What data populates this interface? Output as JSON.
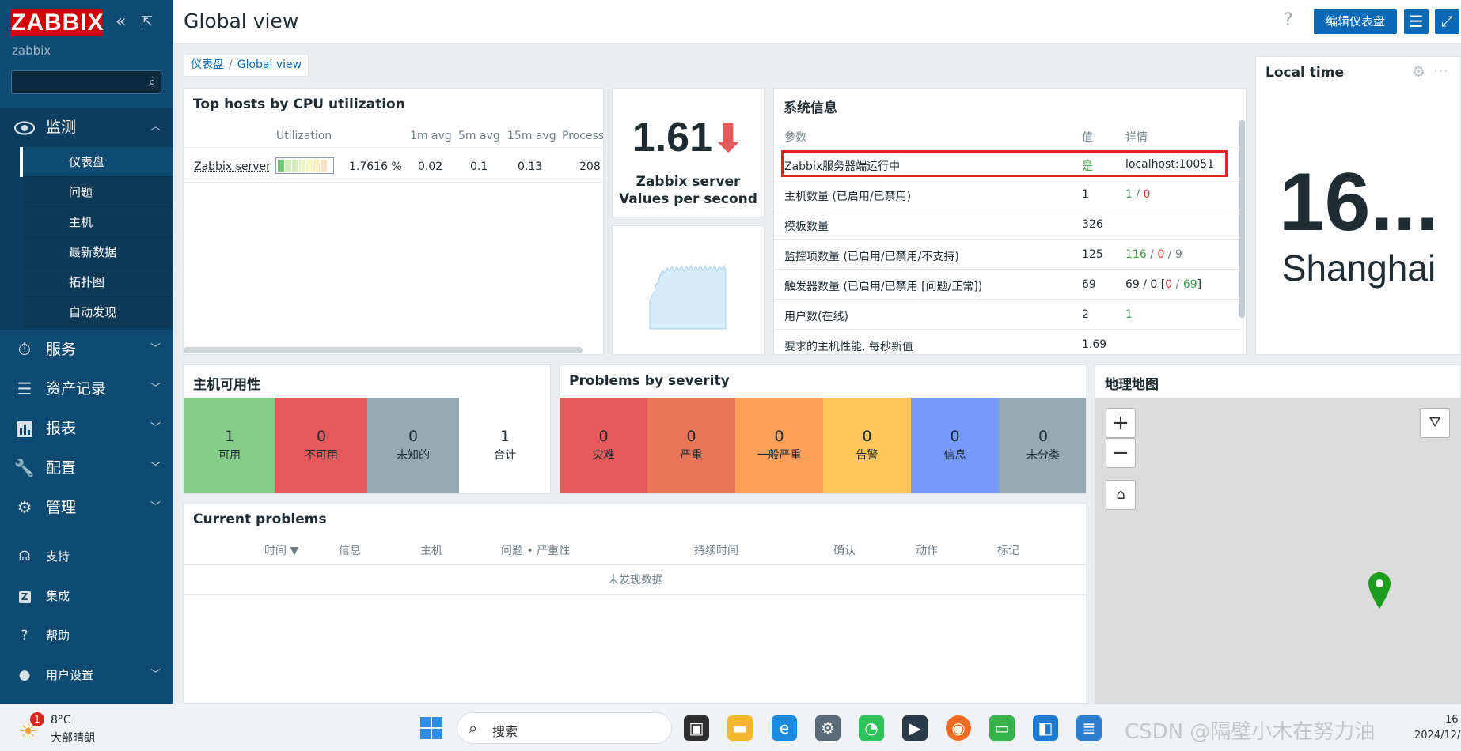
{
  "app": {
    "logo": "ZABBIX",
    "server_name": "zabbix",
    "page_title": "Global view"
  },
  "sidebar": {
    "collapse_icon": "double-chevron-left-icon",
    "kiosk_icon": "kiosk-icon",
    "search_placeholder": "",
    "menu": [
      {
        "label": "监测",
        "icon": "eye-icon",
        "expanded": true,
        "children": [
          "仪表盘",
          "问题",
          "主机",
          "最新数据",
          "拓扑图",
          "自动发现"
        ],
        "selected": 0
      },
      {
        "label": "服务",
        "icon": "stopwatch-icon"
      },
      {
        "label": "资产记录",
        "icon": "list-icon"
      },
      {
        "label": "报表",
        "icon": "bar-chart-icon"
      },
      {
        "label": "配置",
        "icon": "wrench-icon"
      },
      {
        "label": "管理",
        "icon": "gear-icon"
      }
    ],
    "bottom": [
      {
        "label": "支持",
        "icon": "headset-icon"
      },
      {
        "label": "集成",
        "icon": "integration-icon"
      },
      {
        "label": "帮助",
        "icon": "help-icon"
      },
      {
        "label": "用户设置",
        "icon": "user-icon"
      }
    ]
  },
  "header": {
    "edit_button": "编辑仪表盘",
    "help_icon": "question-icon",
    "menu_icon": "hamburger-icon",
    "fullscreen_icon": "fullscreen-icon"
  },
  "breadcrumb": {
    "root": "仪表盘",
    "current": "Global view"
  },
  "top_hosts": {
    "title": "Top hosts by CPU utilization",
    "columns": [
      "Utilization",
      "1m avg",
      "5m avg",
      "15m avg",
      "Process"
    ],
    "rows": [
      {
        "host": "Zabbix server",
        "utilization": "1.7616 %",
        "avg1": "0.02",
        "avg5": "0.1",
        "avg15": "0.13",
        "processes": "208"
      }
    ]
  },
  "vps": {
    "value": "1.61",
    "trend": "down",
    "label_line1": "Zabbix server",
    "label_line2": "Values per second"
  },
  "system_info": {
    "title": "系统信息",
    "columns": [
      "参数",
      "值",
      "详情"
    ],
    "rows": [
      {
        "param": "Zabbix服务器端运行中",
        "value": "是",
        "details": "localhost:10051",
        "value_color": "#429e47",
        "highlighted": true
      },
      {
        "param": "主机数量 (已启用/已禁用)",
        "value": "1",
        "d1": "1",
        "dsep": " / ",
        "d2": "0"
      },
      {
        "param": "模板数量",
        "value": "326",
        "details": ""
      },
      {
        "param": "监控项数量 (已启用/已禁用/不支持)",
        "value": "125",
        "d1": "116",
        "dsep": " / ",
        "d2": "0",
        "dsep2": " / ",
        "d3": "9"
      },
      {
        "param": "触发器数量 (已启用/已禁用 [问题/正常])",
        "value": "69",
        "d0": "69 / 0 [",
        "d2": "0",
        "dsep": " / ",
        "d1": "69",
        "dend": "]"
      },
      {
        "param": "用户数(在线)",
        "value": "2",
        "d1": "1"
      },
      {
        "param": "要求的主机性能, 每秒新值",
        "value": "1.69",
        "details": ""
      }
    ]
  },
  "local_time": {
    "title": "Local time",
    "time": "16...",
    "city": "Shanghai",
    "gear_icon": "gear-icon",
    "more_icon": "more-icon"
  },
  "host_availability": {
    "title": "主机可用性",
    "cells": [
      {
        "count": "1",
        "label": "可用",
        "color": "#86cc89"
      },
      {
        "count": "0",
        "label": "不可用",
        "color": "#e45959"
      },
      {
        "count": "0",
        "label": "未知的",
        "color": "#97aab3"
      },
      {
        "count": "1",
        "label": "合计",
        "color": "#ffffff"
      }
    ]
  },
  "problems_by_severity": {
    "title": "Problems by severity",
    "cells": [
      {
        "count": "0",
        "label": "灾难",
        "color": "#e45959"
      },
      {
        "count": "0",
        "label": "严重",
        "color": "#e97659"
      },
      {
        "count": "0",
        "label": "一般严重",
        "color": "#ffa059"
      },
      {
        "count": "0",
        "label": "告警",
        "color": "#ffc859"
      },
      {
        "count": "0",
        "label": "信息",
        "color": "#7499ff"
      },
      {
        "count": "0",
        "label": "未分类",
        "color": "#97aab3"
      }
    ]
  },
  "current_problems": {
    "title": "Current problems",
    "columns": [
      "时间 ▼",
      "信息",
      "主机",
      "问题 • 严重性",
      "持续时间",
      "确认",
      "动作",
      "标记"
    ],
    "empty_text": "未发现数据"
  },
  "geomap": {
    "title": "地理地图",
    "zoom_in": "+",
    "zoom_out": "−",
    "home_icon": "home-icon",
    "filter_icon": "filter-icon",
    "marker_icon": "map-marker-icon"
  },
  "taskbar": {
    "weather_temp": "8°C",
    "weather_text": "大部晴朗",
    "weather_badge": "1",
    "search_label": "搜索",
    "watermark": "CSDN @隔壁小木在努力油",
    "clock_time": "16",
    "clock_date": "2024/12/"
  }
}
